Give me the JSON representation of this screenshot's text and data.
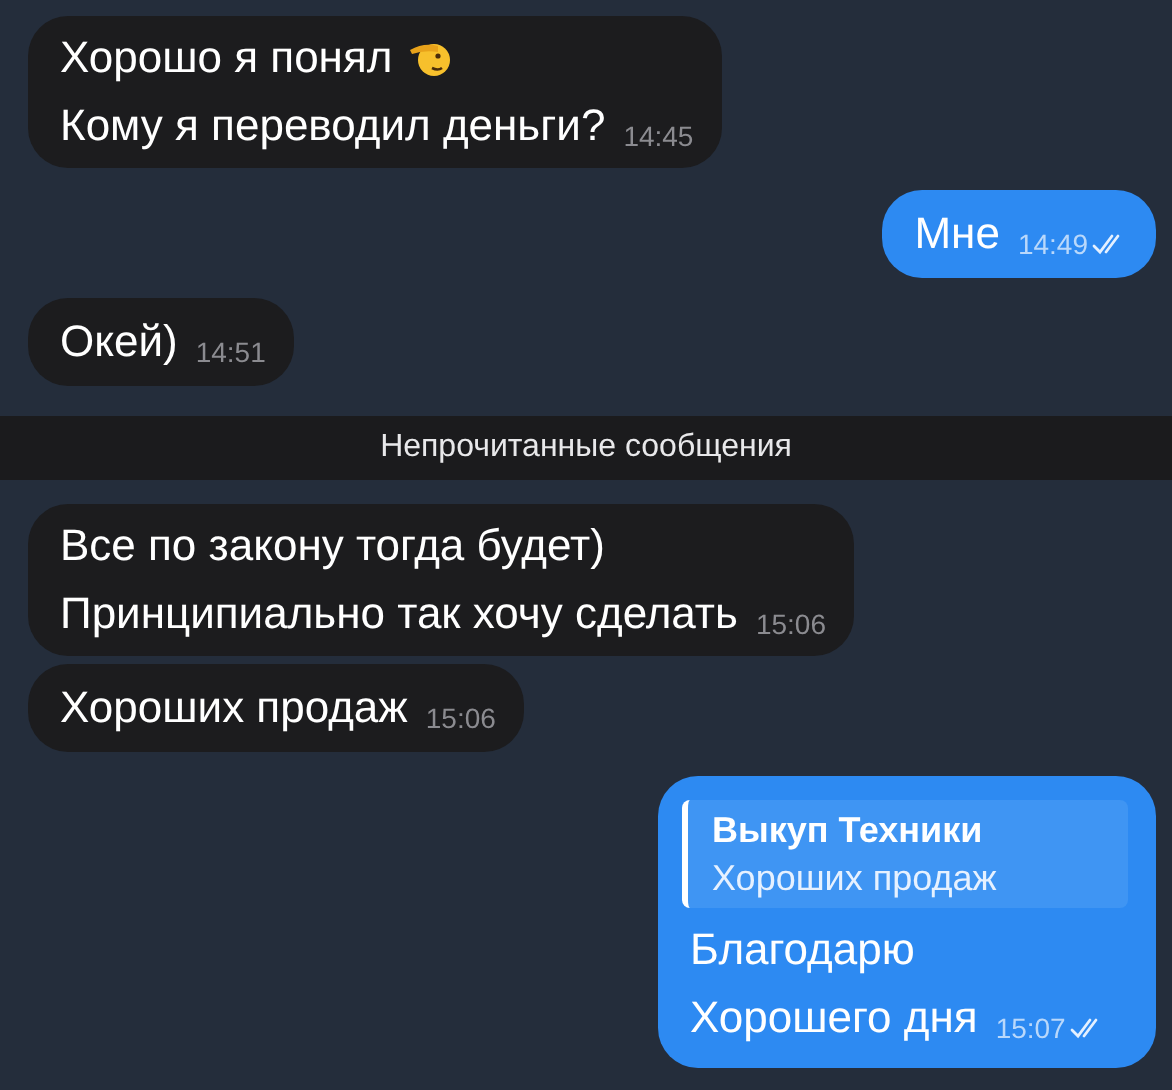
{
  "messages": [
    {
      "kind": "message",
      "outgoing": false,
      "lines": [
        "Хорошо я понял",
        "Кому я переводил деньги?"
      ],
      "emoji": true,
      "time": "14:45"
    },
    {
      "kind": "message",
      "outgoing": true,
      "lines": [
        "Мне"
      ],
      "time": "14:49",
      "read": true
    },
    {
      "kind": "message",
      "outgoing": false,
      "lines": [
        "Окей)"
      ],
      "time": "14:51"
    },
    {
      "kind": "divider",
      "text": "Непрочитанные сообщения"
    },
    {
      "kind": "message",
      "outgoing": false,
      "lines": [
        "Все по закону тогда будет)",
        "Принципиально так хочу сделать"
      ],
      "time": "15:06"
    },
    {
      "kind": "message",
      "outgoing": false,
      "lines": [
        "Хороших продаж"
      ],
      "time": "15:06"
    },
    {
      "kind": "message",
      "outgoing": true,
      "reply": {
        "author": "Выкуп Техники",
        "text": "Хороших продаж"
      },
      "lines": [
        "Благодарю",
        "Хорошего дня"
      ],
      "time": "15:07",
      "read": true
    }
  ]
}
